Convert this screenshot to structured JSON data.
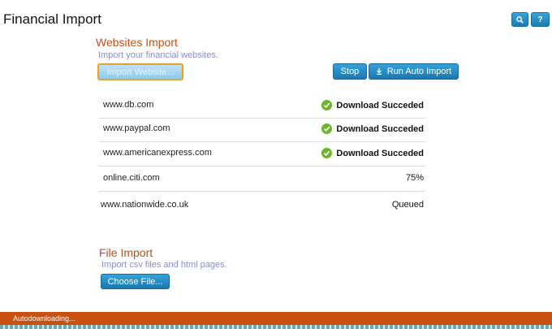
{
  "app": {
    "title": "Financial Import"
  },
  "toolbar": {
    "search_icon": "search-icon",
    "help_label": "?"
  },
  "websites_import": {
    "title": "Websites Import",
    "subtitle": "Import your financial websites.",
    "import_button_label": "Import Website...",
    "stop_label": "Stop",
    "run_auto_label": "Run Auto Import",
    "rows": [
      {
        "site": "www.db.com",
        "status": "Download Succeded",
        "succeeded": true
      },
      {
        "site": "www.paypal.com",
        "status": "Download Succeded",
        "succeeded": true
      },
      {
        "site": "www.americanexpress.com",
        "status": "Download Succeded",
        "succeeded": true
      },
      {
        "site": "online.citi.com",
        "status": "75%",
        "succeeded": false
      },
      {
        "site": "www.nationwide.co.uk",
        "status": "Queued",
        "succeeded": false
      }
    ]
  },
  "file_import": {
    "title": "File Import",
    "subtitle": "Import csv files and html pages.",
    "choose_label": "Choose File..."
  },
  "status_bar": {
    "text": "Autodownloading..."
  },
  "colors": {
    "accent": "#1b7bb3",
    "section_title": "#c0501a",
    "status_bar": "#c9500e",
    "success": "#6cb52d"
  }
}
